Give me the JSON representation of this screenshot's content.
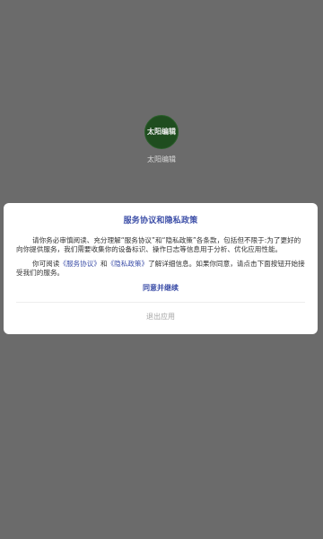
{
  "app": {
    "logo_text": "太阳编辑",
    "name": "太阳编辑"
  },
  "dialog": {
    "title": "服务协议和隐私政策",
    "paragraph1": "请你务必审慎阅读、充分理解“服务协议”和“隐私政策”各条款，包括但不限于:为了更好的向你提供服务，我们需要收集你的设备标识、操作日志等信息用于分析、优化应用性能。",
    "paragraph2_prefix": "你可阅读",
    "service_link": "《服务协议》",
    "and": "和",
    "privacy_link": "《隐私政策》",
    "paragraph2_suffix": "了解详细信息。如果你同意，请点击下面按钮开始接受我们的服务。",
    "agree_label": "同意并继续",
    "exit_label": "退出应用"
  },
  "colors": {
    "backdrop": "#6b6b6b",
    "logo_bg": "#1f4d1f",
    "accent": "#3d4fa8",
    "muted": "#a7a7a7"
  }
}
